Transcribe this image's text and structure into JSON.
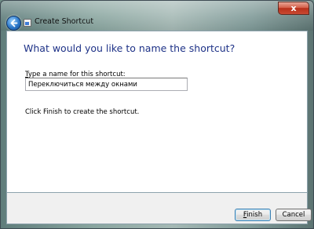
{
  "window": {
    "title": "Create Shortcut",
    "close_label": "x"
  },
  "main": {
    "heading": "What would you like to name the shortcut?",
    "field_label_accel": "T",
    "field_label_rest": "ype a name for this shortcut:",
    "name_value": "Переключиться между окнами",
    "hint": "Click Finish to create the shortcut."
  },
  "footer": {
    "finish_accel": "F",
    "finish_rest": "inish",
    "cancel_label": "Cancel"
  }
}
